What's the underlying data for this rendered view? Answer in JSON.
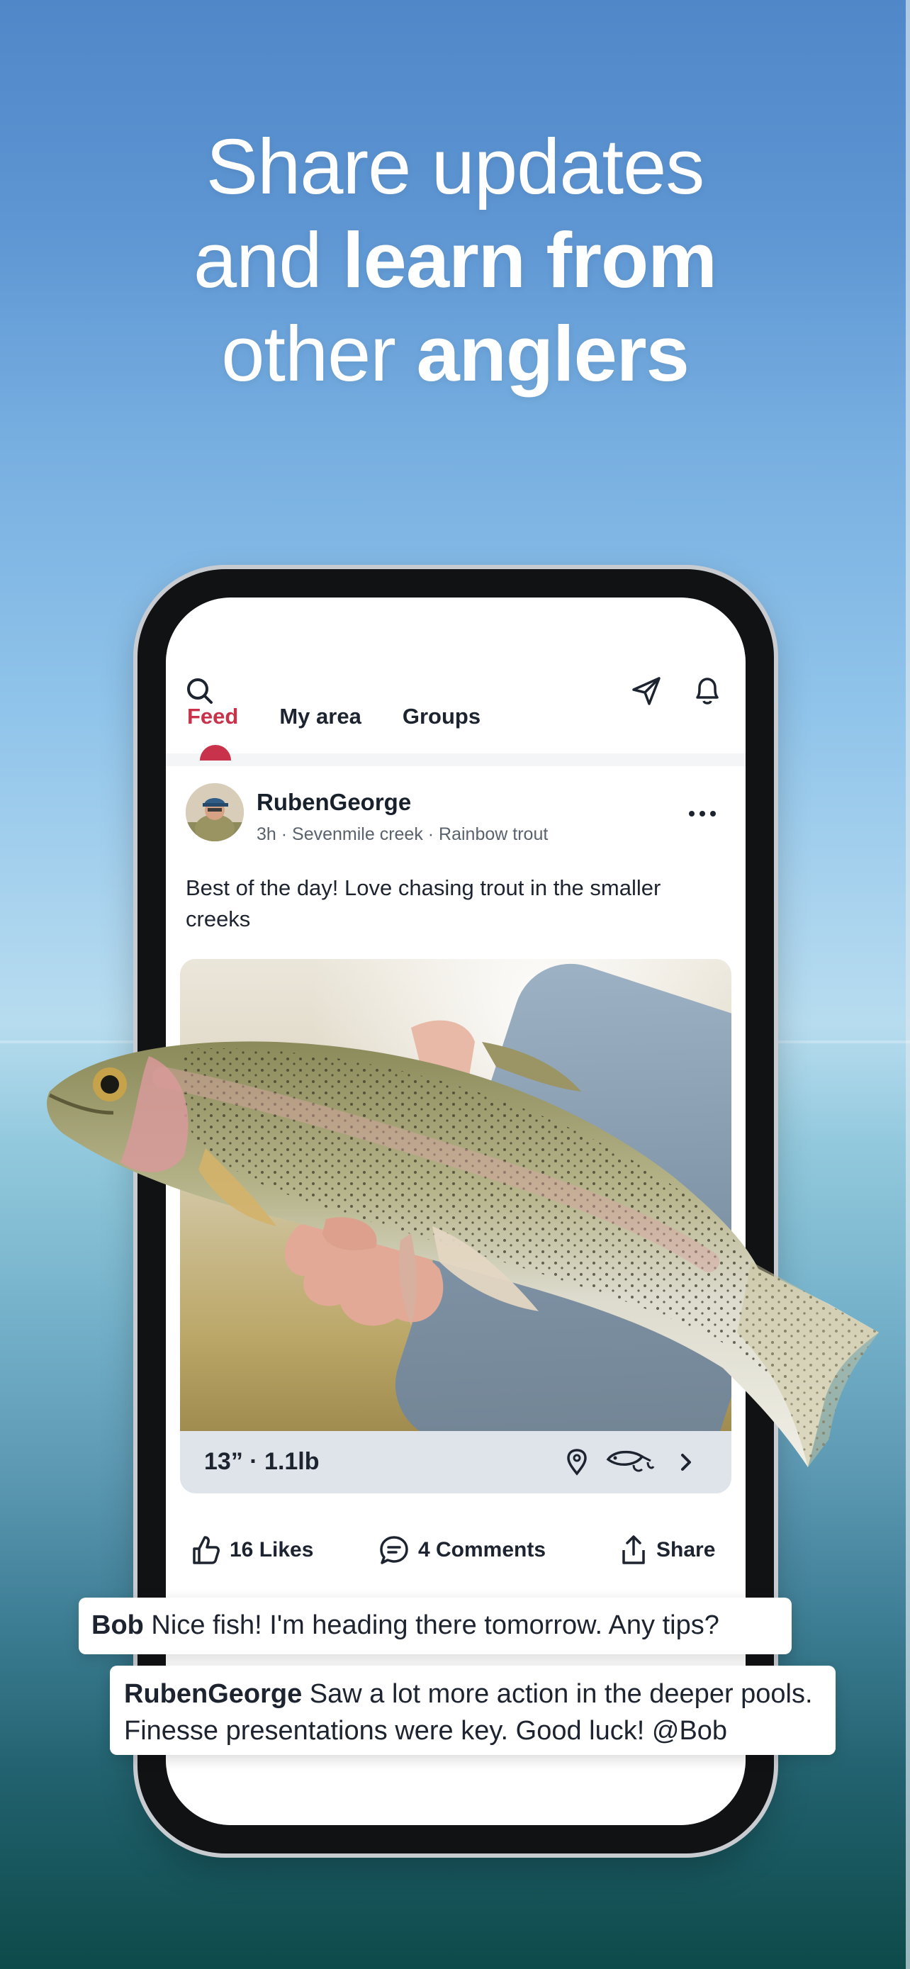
{
  "headline": {
    "line1": "Share updates",
    "line2_prefix": "and ",
    "line2_bold": "learn from",
    "line3_prefix": "other ",
    "line3_bold": "anglers"
  },
  "topbar": {
    "icons": [
      "search-icon",
      "send-icon",
      "bell-icon"
    ],
    "tabs": [
      {
        "label": "Feed",
        "active": true
      },
      {
        "label": "My area",
        "active": false
      },
      {
        "label": "Groups",
        "active": false
      }
    ]
  },
  "post": {
    "username": "RubenGeorge",
    "meta": "3h · Sevenmile creek · Rainbow trout",
    "caption": "Best of the day! Love chasing trout in the smaller creeks",
    "catch_size": "13” · 1.1lb",
    "info_icons": [
      "location-pin-icon",
      "lure-icon",
      "chevron-right-icon"
    ],
    "likes_label": "16 Likes",
    "comments_label": "4 Comments",
    "share_label": "Share"
  },
  "comments": [
    {
      "author": "Bob",
      "text": " Nice fish! I'm heading there tomorrow. Any tips?"
    },
    {
      "author": "RubenGeorge",
      "text_line1": " Saw a lot more action in the deeper pools.",
      "text_line2": "Finesse presentations were key. Good luck! @Bob"
    }
  ],
  "colors": {
    "accent": "#c8324a",
    "text_dark": "#1d2430",
    "sky": "#5f97d4"
  }
}
